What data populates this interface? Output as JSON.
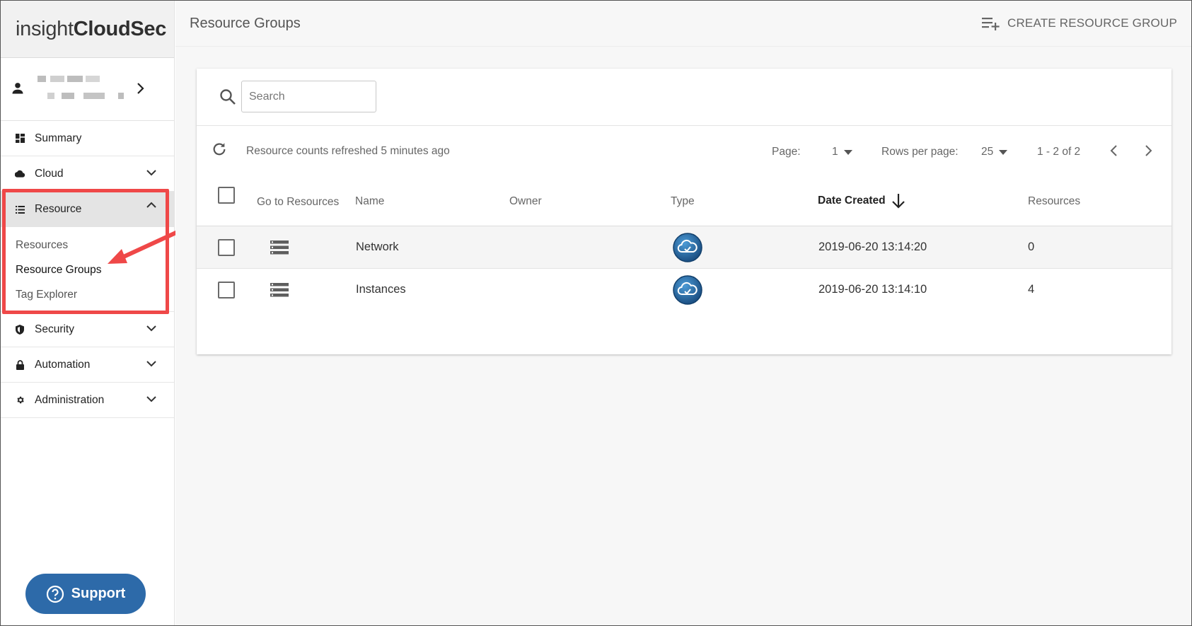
{
  "app": {
    "logo_light": "insight",
    "logo_bold": "CloudSec"
  },
  "sidebar": {
    "items": [
      {
        "label": "Summary"
      },
      {
        "label": "Cloud"
      },
      {
        "label": "Resource"
      },
      {
        "label": "Security"
      },
      {
        "label": "Automation"
      },
      {
        "label": "Administration"
      }
    ],
    "resource_sub": [
      {
        "label": "Resources"
      },
      {
        "label": "Resource Groups"
      },
      {
        "label": "Tag Explorer"
      }
    ],
    "support_label": "Support"
  },
  "header": {
    "title": "Resource Groups",
    "create_label": "CREATE RESOURCE GROUP"
  },
  "search": {
    "placeholder": "Search"
  },
  "toolbar": {
    "refresh_text": "Resource counts refreshed 5 minutes ago",
    "page_label": "Page:",
    "page_value": "1",
    "rows_label": "Rows per page:",
    "rows_value": "25",
    "range": "1 - 2 of 2"
  },
  "table": {
    "columns": [
      "Go to Resources",
      "Name",
      "Owner",
      "Type",
      "Date Created",
      "Resources"
    ],
    "rows": [
      {
        "name": "Network",
        "owner": "",
        "date": "2019-06-20 13:14:20",
        "resources": "0"
      },
      {
        "name": "Instances",
        "owner": "",
        "date": "2019-06-20 13:14:10",
        "resources": "4"
      }
    ]
  },
  "colors": {
    "accent": "#2d6aa9",
    "highlight": "#ef4848"
  },
  "icons": {
    "user": "user-icon",
    "summary": "dashboard-icon",
    "cloud": "cloud-icon",
    "resource": "list-icon",
    "security": "shield-icon",
    "automation": "lock-icon",
    "administration": "gear-icon",
    "search": "search-icon",
    "refresh": "refresh-icon",
    "create": "playlist-add-icon",
    "sort": "arrow-down-icon",
    "type": "cloud-sync-icon"
  }
}
